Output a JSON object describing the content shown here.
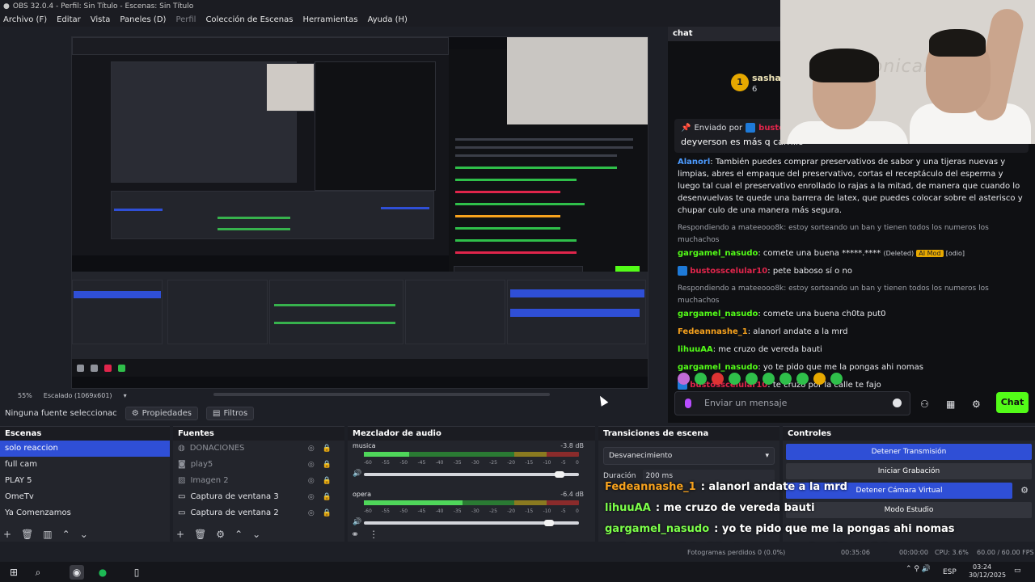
{
  "window": {
    "title": "OBS 32.0.4 - Perfil: Sin Título - Escenas: Sin Título"
  },
  "menu": [
    "Archivo (F)",
    "Editar",
    "Vista",
    "Paneles (D)",
    "Perfil",
    "Colección de Escenas",
    "Herramientas",
    "Ayuda (H)"
  ],
  "zoom": {
    "percent": "55%",
    "scale": "Escalado (1069x601)"
  },
  "source_toolbar": {
    "no_source": "Ninguna fuente seleccionac",
    "properties": "Propiedades",
    "filters": "Filtros"
  },
  "scenes": {
    "title": "Escenas",
    "items": [
      "solo reaccion",
      "full cam",
      "PLAY 5",
      "OmeTv",
      "Ya Comenzamos"
    ],
    "selected": 0
  },
  "sources": {
    "title": "Fuentes",
    "items": [
      {
        "name": "DONACIONES",
        "icon": "globe-icon",
        "active": false
      },
      {
        "name": "play5",
        "icon": "camera-icon",
        "active": false
      },
      {
        "name": "Imagen 2",
        "icon": "image-icon",
        "active": false
      },
      {
        "name": "Captura de ventana 3",
        "icon": "window-icon",
        "active": true
      },
      {
        "name": "Captura de ventana 2",
        "icon": "window-icon",
        "active": true
      }
    ]
  },
  "mixer": {
    "title": "Mezclador de audio",
    "tracks": [
      {
        "name": "musica",
        "db": "-3.8 dB",
        "level": 0.21,
        "volume": 0.91
      },
      {
        "name": "opera",
        "db": "-6.4 dB",
        "level": 0.46,
        "volume": 0.86
      }
    ],
    "scale": [
      "-60",
      "-55",
      "-50",
      "-45",
      "-40",
      "-35",
      "-30",
      "-25",
      "-20",
      "-15",
      "-10",
      "-5",
      "0"
    ]
  },
  "transitions": {
    "title": "Transiciones de escena",
    "selected": "Desvanecimiento",
    "duration_label": "Duración",
    "duration_value": "200 ms"
  },
  "controls": {
    "title": "Controles",
    "buttons": [
      "Detener Transmisión",
      "Iniciar Grabación",
      "Detener Cámara Virtual",
      "Modo Estudio"
    ]
  },
  "status": {
    "frames": "Fotogramas perdidos 0 (0.0%)",
    "stream_time": "00:35:06",
    "rec_time": "00:00:00",
    "cpu": "CPU: 3.6%",
    "fps": "60.00 / 60.00 FPS"
  },
  "taskbar": {
    "lang": "ESP",
    "time": "03:24",
    "date": "30/12/2025"
  },
  "chat": {
    "tab": "chat",
    "sub_name": "sashac",
    "sub_count": "6",
    "badge_value": "1",
    "pinned_label": "Enviado por",
    "pinned_user": "bustosscel",
    "pinned_message": "deyverson es más q carrillo",
    "messages": [
      {
        "user": "Alanorl",
        "color": "#4d9bff",
        "text": ": También puedes comprar preservativos de sabor y una tijeras nuevas y limpias, abres el empaque del preservativo, cortas el receptáculo del esperma y luego tal cual el preservativo enrollado lo rajas a la mitad, de manera que cuando lo desenvuelvas te quede una barrera de latex, que puedes colocar sobre el asterisco y chupar culo de una manera más segura."
      },
      {
        "reply": "Respondiendo a mateeooo8k: estoy sorteando un ban y tienen todos los numeros los muchachos",
        "user": "gargamel_nasudo",
        "color": "#53fc18",
        "text": ": comete una buena *****.****",
        "deleted": "(Deleted)",
        "badge": "AI Mod",
        "tag": "[odio]"
      },
      {
        "user": "bustosscelular10",
        "color": "#e0254b",
        "text": ": pete baboso sí o no",
        "kick": true
      },
      {
        "reply": "Respondiendo a mateeooo8k: estoy sorteando un ban y tienen todos los numeros los muchachos",
        "user": "gargamel_nasudo",
        "color": "#53fc18",
        "text": ": comete una buena ch0ta put0"
      },
      {
        "user": "Fedeannashe_1",
        "color": "#f7a21d",
        "text": ": alanorl andate a la mrd"
      },
      {
        "user": "lihuuAA",
        "color": "#53fc18",
        "text": ": me cruzo de vereda bauti"
      },
      {
        "user": "gargamel_nasudo",
        "color": "#53fc18",
        "text": ": yo te pido que me la pongas ahi nomas"
      },
      {
        "user": "bustosscelular10",
        "color": "#e0254b",
        "text": ": te cruzo por la calle te fajo",
        "kick": true
      }
    ],
    "input_placeholder": "Enviar un mensaje",
    "send_label": "Chat"
  },
  "webcam": {
    "wall_text": "Sonicamil7 KICK"
  },
  "overlay_chat": [
    {
      "user": "Fedeannashe_1",
      "color": "#f7a21d",
      "text": ": alanorl andate a la mrd"
    },
    {
      "user": "lihuuAA",
      "color": "#7cff4a",
      "text": ": me cruzo de vereda bauti"
    },
    {
      "user": "gargamel_nasudo",
      "color": "#7cff4a",
      "text": ": yo te pido que me la pongas ahi nomas"
    },
    {
      "user": "bustosscelular10",
      "color": "#e0254b",
      "text": ": te cruzo por la calle te fajo",
      "kick": true
    }
  ]
}
